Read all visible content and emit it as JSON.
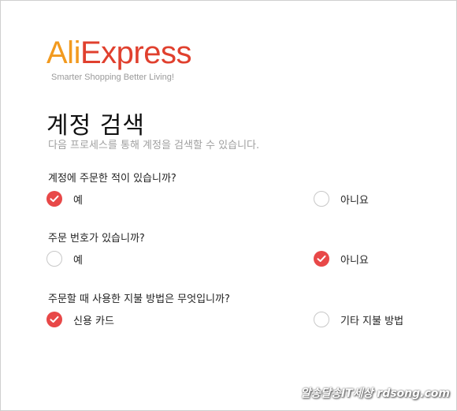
{
  "brand": {
    "logo_ali": "Ali",
    "logo_express": "Express",
    "tagline": "Smarter Shopping Better Living!",
    "colors": {
      "orange": "#f29a1f",
      "red": "#e0402e",
      "accent": "#e84848"
    }
  },
  "page": {
    "title": "계정 검색",
    "subtitle": "다음 프로세스를 통해 계정을 검색할 수 있습니다."
  },
  "questions": [
    {
      "text": "계정에 주문한 적이 있습니까?",
      "options": [
        {
          "label": "예",
          "checked": true
        },
        {
          "label": "아니요",
          "checked": false
        }
      ]
    },
    {
      "text": "주문 번호가 있습니까?",
      "options": [
        {
          "label": "예",
          "checked": false
        },
        {
          "label": "아니요",
          "checked": true
        }
      ]
    },
    {
      "text": "주문할 때 사용한 지불 방법은 무엇입니까?",
      "options": [
        {
          "label": "신용 카드",
          "checked": true
        },
        {
          "label": "기타 지불 방법",
          "checked": false
        }
      ]
    }
  ],
  "watermark": "알송달송IT세상 rdsong.com"
}
